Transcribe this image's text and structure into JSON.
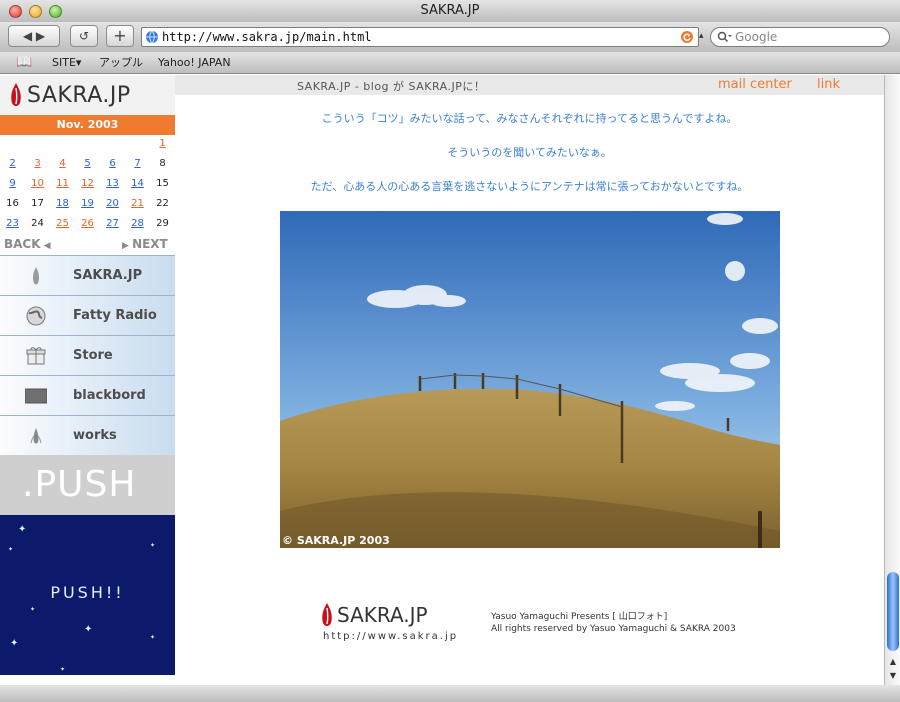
{
  "window": {
    "title": "SAKRA.JP"
  },
  "toolbar": {
    "url": "http://www.sakra.jp/main.html",
    "search_placeholder": "Google",
    "back": "◀ ▶",
    "reload": "↺",
    "add": "+"
  },
  "bookmarks": {
    "items": [
      "SITE▾",
      "アップル",
      "Yahoo! JAPAN"
    ]
  },
  "sidebar": {
    "logo": "SAKRA.JP",
    "month": "Nov. 2003",
    "calendar": [
      {
        "d": "1",
        "c": "org",
        "col": 6,
        "row": 0
      },
      {
        "d": "2",
        "c": "blue",
        "col": 0,
        "row": 1
      },
      {
        "d": "3",
        "c": "org",
        "col": 1,
        "row": 1
      },
      {
        "d": "4",
        "c": "org",
        "col": 2,
        "row": 1
      },
      {
        "d": "5",
        "c": "blue",
        "col": 3,
        "row": 1
      },
      {
        "d": "6",
        "c": "blue",
        "col": 4,
        "row": 1
      },
      {
        "d": "7",
        "c": "blue",
        "col": 5,
        "row": 1
      },
      {
        "d": "8",
        "c": "plain",
        "col": 6,
        "row": 1
      },
      {
        "d": "9",
        "c": "blue",
        "col": 0,
        "row": 2
      },
      {
        "d": "10",
        "c": "org",
        "col": 1,
        "row": 2
      },
      {
        "d": "11",
        "c": "org",
        "col": 2,
        "row": 2
      },
      {
        "d": "12",
        "c": "org",
        "col": 3,
        "row": 2
      },
      {
        "d": "13",
        "c": "blue",
        "col": 4,
        "row": 2
      },
      {
        "d": "14",
        "c": "blue",
        "col": 5,
        "row": 2
      },
      {
        "d": "15",
        "c": "plain",
        "col": 6,
        "row": 2
      },
      {
        "d": "16",
        "c": "plain",
        "col": 0,
        "row": 3
      },
      {
        "d": "17",
        "c": "plain",
        "col": 1,
        "row": 3
      },
      {
        "d": "18",
        "c": "blue",
        "col": 2,
        "row": 3
      },
      {
        "d": "19",
        "c": "blue",
        "col": 3,
        "row": 3
      },
      {
        "d": "20",
        "c": "blue",
        "col": 4,
        "row": 3
      },
      {
        "d": "21",
        "c": "org",
        "col": 5,
        "row": 3
      },
      {
        "d": "22",
        "c": "plain",
        "col": 6,
        "row": 3
      },
      {
        "d": "23",
        "c": "blue",
        "col": 0,
        "row": 4
      },
      {
        "d": "24",
        "c": "plain",
        "col": 1,
        "row": 4
      },
      {
        "d": "25",
        "c": "org",
        "col": 2,
        "row": 4
      },
      {
        "d": "26",
        "c": "org",
        "col": 3,
        "row": 4
      },
      {
        "d": "27",
        "c": "blue",
        "col": 4,
        "row": 4
      },
      {
        "d": "28",
        "c": "blue",
        "col": 5,
        "row": 4
      },
      {
        "d": "29",
        "c": "plain",
        "col": 6,
        "row": 4
      }
    ],
    "back": "BACK",
    "next": "NEXT",
    "menu": [
      {
        "label": "SAKRA.JP",
        "icon": "sakra-drop-icon"
      },
      {
        "label": "Fatty Radio",
        "icon": "globe-icon"
      },
      {
        "label": "Store",
        "icon": "gift-icon"
      },
      {
        "label": "blackbord",
        "icon": "blackboard-icon"
      },
      {
        "label": "works",
        "icon": "works-drop-icon"
      }
    ],
    "push": ".PUSH",
    "banner": "PUSH!!"
  },
  "content": {
    "header": "SAKRA.JP - blog が SAKRA.JPに！",
    "mail": "mail center",
    "link": "link",
    "paragraphs": [
      "こういう「コツ」みたいな話って、みなさんそれぞれに持ってると思うんですよね。",
      "そういうのを聞いてみたいなぁ。",
      "ただ、心ある人の心ある言葉を逃さないようにアンテナは常に張っておかないとですね。"
    ],
    "photo_caption": "© SAKRA.JP 2003",
    "footer": {
      "logo": "SAKRA.JP",
      "url": "http://www.sakra.jp",
      "line1": "Yasuo Yamaguchi Presents [ 山口フォト]",
      "line2": "All rights reserved by Yasuo Yamaguchi & SAKRA 2003"
    }
  },
  "colors": {
    "accent": "#f07a30",
    "link": "#3a82d6",
    "banner": "#0b1a6a"
  }
}
